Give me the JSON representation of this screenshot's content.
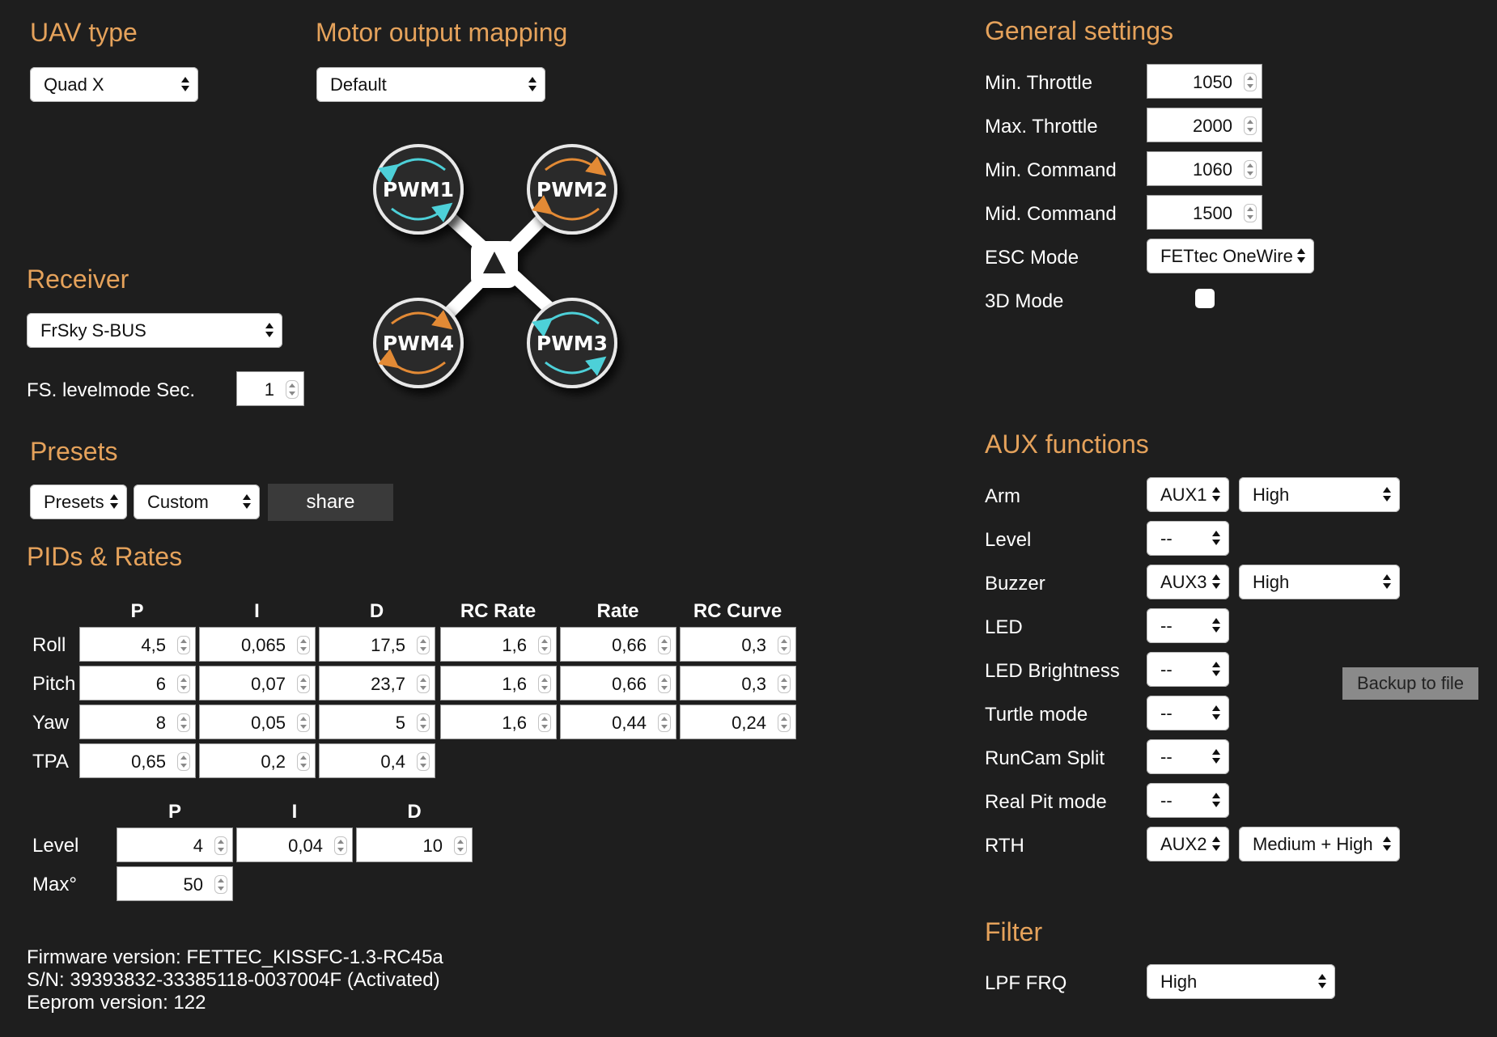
{
  "uav": {
    "heading": "UAV type",
    "value": "Quad X"
  },
  "motor": {
    "heading": "Motor output mapping",
    "value": "Default",
    "motors": [
      "PWM1",
      "PWM2",
      "PWM4",
      "PWM3"
    ]
  },
  "receiver": {
    "heading": "Receiver",
    "value": "FrSky S-BUS",
    "fs_label": "FS. levelmode Sec.",
    "fs_value": "1"
  },
  "presets": {
    "heading": "Presets",
    "preset_value": "Presets",
    "custom_value": "Custom",
    "share_label": "share"
  },
  "pids": {
    "heading": "PIDs & Rates",
    "columns": [
      "P",
      "I",
      "D",
      "RC Rate",
      "Rate",
      "RC Curve"
    ],
    "rows": [
      {
        "label": "Roll",
        "values": [
          "4,5",
          "0,065",
          "17,5",
          "1,6",
          "0,66",
          "0,3"
        ]
      },
      {
        "label": "Pitch",
        "values": [
          "6",
          "0,07",
          "23,7",
          "1,6",
          "0,66",
          "0,3"
        ]
      },
      {
        "label": "Yaw",
        "values": [
          "8",
          "0,05",
          "5",
          "1,6",
          "0,44",
          "0,24"
        ]
      },
      {
        "label": "TPA",
        "values": [
          "0,65",
          "0,2",
          "0,4"
        ]
      }
    ],
    "level_columns": [
      "P",
      "I",
      "D"
    ],
    "level_rows": [
      {
        "label": "Level",
        "values": [
          "4",
          "0,04",
          "10"
        ]
      },
      {
        "label": "Max°",
        "values": [
          "50"
        ]
      }
    ]
  },
  "info": {
    "firmware": "Firmware version: FETTEC_KISSFC-1.3-RC45a",
    "serial": "S/N: 39393832-33385118-0037004F (Activated)",
    "eeprom": "Eeprom version: 122"
  },
  "general": {
    "heading": "General settings",
    "min_throttle_label": "Min. Throttle",
    "min_throttle": "1050",
    "max_throttle_label": "Max. Throttle",
    "max_throttle": "2000",
    "min_command_label": "Min. Command",
    "min_command": "1060",
    "mid_command_label": "Mid. Command",
    "mid_command": "1500",
    "esc_mode_label": "ESC Mode",
    "esc_mode": "FETtec OneWire",
    "mode3d_label": "3D Mode"
  },
  "aux": {
    "heading": "AUX functions",
    "items": [
      {
        "label": "Arm",
        "channel": "AUX1",
        "level": "High"
      },
      {
        "label": "Level",
        "channel": "--",
        "level": ""
      },
      {
        "label": "Buzzer",
        "channel": "AUX3",
        "level": "High"
      },
      {
        "label": "LED",
        "channel": "--",
        "level": ""
      },
      {
        "label": "LED Brightness",
        "channel": "--",
        "level": ""
      },
      {
        "label": "Turtle mode",
        "channel": "--",
        "level": ""
      },
      {
        "label": "RunCam Split",
        "channel": "--",
        "level": ""
      },
      {
        "label": "Real Pit mode",
        "channel": "--",
        "level": ""
      },
      {
        "label": "RTH",
        "channel": "AUX2",
        "level": "Medium + High"
      }
    ],
    "backup_label": "Backup to file"
  },
  "filter": {
    "heading": "Filter",
    "lpf_label": "LPF FRQ",
    "lpf_value": "High"
  },
  "colors": {
    "accent": "#e5a25b",
    "background": "#1e1e1e",
    "cw_arrow": "#e38a35",
    "ccw_arrow": "#4dd0d8"
  }
}
